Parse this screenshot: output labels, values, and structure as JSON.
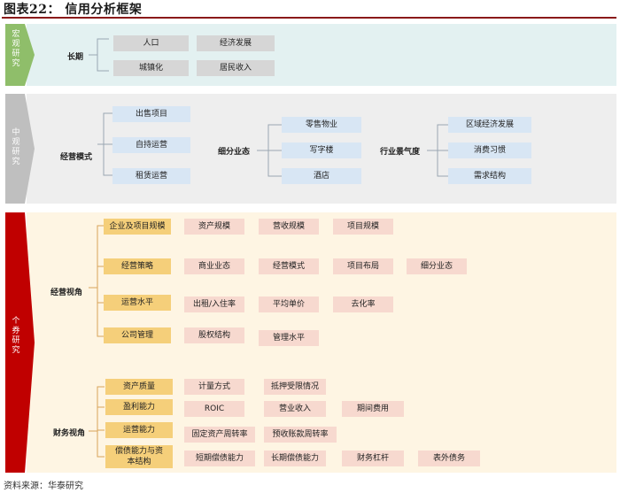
{
  "title": "图表22：  信用分析框架",
  "source": "资料来源：华泰研究",
  "colors": {
    "green": "#8fbe6a",
    "gray": "#bfbfbf",
    "red": "#c00000",
    "macro_bg": "#e3f1f1",
    "mid_bg": "#eeeeee",
    "micro_bg": "#fef5e3"
  },
  "macro": {
    "tag": "宏观研究",
    "label": "长期",
    "items": [
      "人口",
      "经济发展",
      "城镇化",
      "居民收入"
    ]
  },
  "mid": {
    "tag": "中观研究",
    "label_model": "经营模式",
    "models": [
      "出售项目",
      "自持运营",
      "租赁运营"
    ],
    "label_segment": "细分业态",
    "segments": [
      "零售物业",
      "写字楼",
      "酒店"
    ],
    "label_industry": "行业景气度",
    "industry": [
      "区域经济发展",
      "消费习惯",
      "需求结构"
    ]
  },
  "micro": {
    "tag": "个券研究",
    "label_ops": "经营视角",
    "label_fin": "财务视角",
    "ops": [
      {
        "name": "企业及项目规模",
        "items": [
          "资产规模",
          "营收规模",
          "项目规模"
        ]
      },
      {
        "name": "经营策略",
        "items": [
          "商业业态",
          "经营模式",
          "项目布局",
          "细分业态"
        ]
      },
      {
        "name": "运营水平",
        "items": [
          "出租/入住率",
          "平均单价",
          "去化率"
        ]
      },
      {
        "name": "公司管理",
        "items": [
          "股权结构",
          "管理水平"
        ]
      }
    ],
    "fin": [
      {
        "name": "资产质量",
        "items": [
          "计量方式",
          "抵押受限情况"
        ]
      },
      {
        "name": "盈利能力",
        "items": [
          "ROIC",
          "营业收入",
          "期间费用"
        ]
      },
      {
        "name": "运营能力",
        "items": [
          "固定资产周转率",
          "预收账款周转率"
        ]
      },
      {
        "name": "偿债能力与资本结构",
        "items": [
          "短期偿债能力",
          "长期偿债能力",
          "财务杠杆",
          "表外债务"
        ]
      }
    ]
  }
}
